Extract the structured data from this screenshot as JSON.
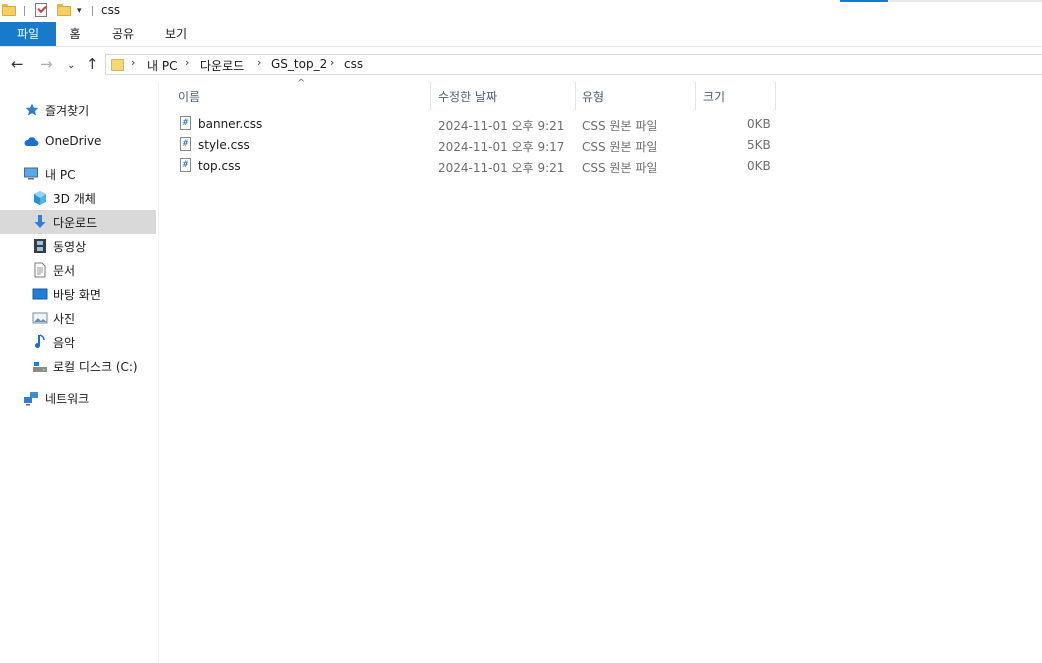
{
  "window": {
    "title": "css"
  },
  "ribbon": {
    "tabs": [
      "파일",
      "홈",
      "공유",
      "보기"
    ]
  },
  "address": {
    "crumbs": [
      "내 PC",
      "다운로드",
      "GS_top_2",
      "css"
    ]
  },
  "nav": {
    "items": [
      {
        "label": "즐겨찾기",
        "icon": "star-icon"
      },
      {
        "label": "OneDrive",
        "icon": "cloud-icon"
      },
      {
        "label": "내 PC",
        "icon": "computer-icon"
      },
      {
        "label": "3D 개체",
        "icon": "cube-icon"
      },
      {
        "label": "다운로드",
        "icon": "download-arrow-icon",
        "selected": true
      },
      {
        "label": "동영상",
        "icon": "film-icon"
      },
      {
        "label": "문서",
        "icon": "document-icon"
      },
      {
        "label": "바탕 화면",
        "icon": "desktop-icon"
      },
      {
        "label": "사진",
        "icon": "picture-icon"
      },
      {
        "label": "음악",
        "icon": "music-note-icon"
      },
      {
        "label": "로컬 디스크 (C:)",
        "icon": "drive-icon"
      },
      {
        "label": "네트워크",
        "icon": "network-icon"
      }
    ]
  },
  "columns": {
    "name": "이름",
    "modified": "수정한 날짜",
    "type": "유형",
    "size": "크기"
  },
  "files": [
    {
      "name": "banner.css",
      "modified": "2024-11-01 오후 9:21",
      "type": "CSS 원본 파일",
      "size": "0KB",
      "icon_glyph": "#"
    },
    {
      "name": "style.css",
      "modified": "2024-11-01 오후 9:17",
      "type": "CSS 원본 파일",
      "size": "5KB",
      "icon_glyph": "#"
    },
    {
      "name": "top.css",
      "modified": "2024-11-01 오후 9:21",
      "type": "CSS 원본 파일",
      "size": "0KB",
      "icon_glyph": "#"
    }
  ],
  "colors": {
    "accent": "#1979ca",
    "selection": "#d9d9d9",
    "header_text": "#4c607a"
  }
}
